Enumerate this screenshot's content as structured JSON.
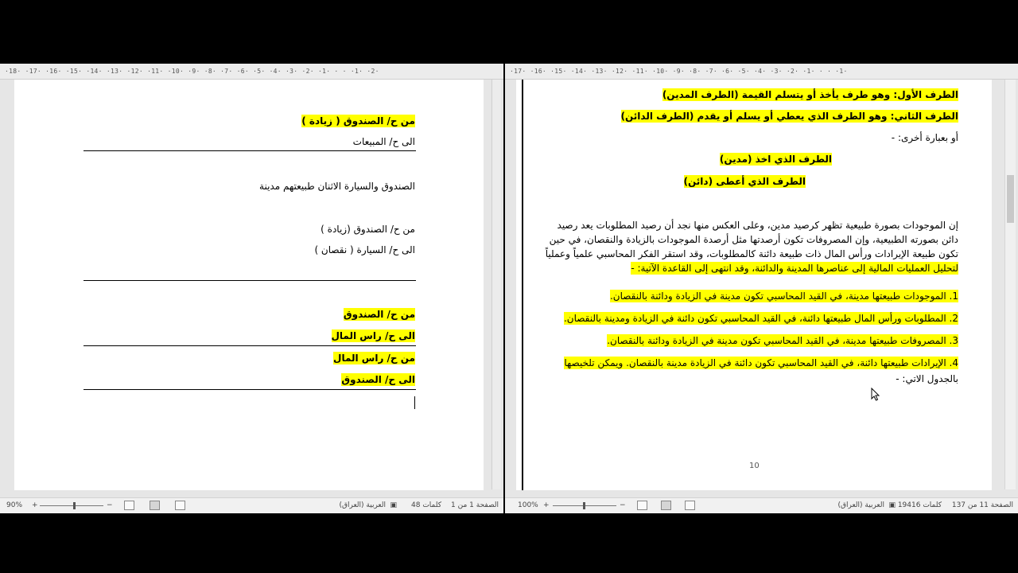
{
  "left_pane": {
    "ruler_text": "·18· ·17· ·16· ·15· ·14· ·13· ·12· ·11· ·10· ·9· ·8· ·7· ·6· ·5· ·4· ·3· ·2· ·1· · · ·1· ·2·",
    "lines": {
      "l1": "من ح/ الصندوق ( زيادة )",
      "l2": "الى ح/ المبيعات",
      "l3": "الصندوق     والسيارة الاثنان طبيعتهم مدينة",
      "l4": "من ح/ الصندوق (زيادة )",
      "l5": "الى ح/ السيارة ( نقصان )",
      "l6": "من ح/ الصندوق",
      "l7": "الى ح/ راس المال",
      "l8": "من ح/ راس المال",
      "l9": "الى ح/ الصندوق"
    },
    "status": {
      "page": "الصفحة 1 من 1",
      "words": "48 كلمات",
      "language": "العربية (العراق)",
      "zoom": "90%",
      "plus": "+",
      "minus": "−"
    }
  },
  "right_pane": {
    "ruler_text": "·17· ·16· ·15· ·14· ·13· ·12· ·11· ·10· ·9· ·8· ·7· ·6· ·5· ·4· ·3· ·2· ·1· · · ·1·",
    "lines": {
      "r1": "الطرف الأول: وهو طرف يأخذ أو يتسلم القيمة (الطرف المدين)",
      "r2": "الطرف الثاني: وهو الطرف الذي يعطي أو يسلم أو يقدم (الطرف الدائن)",
      "r3": "أو بعبارة أخرى: -",
      "r4": "الطرف الذي اخذ (مدين)",
      "r5": "الطرف الذي أعطى (دائن)",
      "p1": "إن الموجودات بصورة طبيعية تظهر كرصيد مدين، وعلى العكس منها نجد أن رصيد المطلوبات يعد رصيد",
      "p2": "دائن بصورته الطبيعية، وإن المصروفات تكون أرصدتها مثل أرصدة الموجودات بالزيادة والنقصان، في حين",
      "p3": "تكون طبيعة الإيرادات ورأس المال ذات طبيعة دائنة كالمطلوبات، وقد استقر الفكر المحاسبي علمياً وعملياً",
      "p4": "لتحليل العمليات المالية إلى عناصرها المدينة والدائنة، وقد انتهى إلى القاعدة الآتية: -",
      "n1": "1. الموجودات طبيعتها مدينة، في القيد المحاسبي تكون مدينة في الزيادة ودائنة بالنقصان.",
      "n2": "2. المطلوبات ورأس المال طبيعتها دائنة، في القيد المحاسبي تكون دائنة في الزيادة ومدينة بالنقصان.",
      "n3": "3. المصروفات طبيعتها مدينة، في القيد المحاسبي تكون مدينة في الزيادة ودائنة بالنقصان.",
      "n4": "4. الإيرادات طبيعتها دائنة، في القيد المحاسبي تكون دائنة في الزيادة مدينة بالنقصان. ويمكن تلخيصها",
      "n5": "بالجدول الاتي: -",
      "page_number": "10"
    },
    "status": {
      "page": "الصفحة 11 من 137",
      "words": "19416 كلمات",
      "language": "العربية (العراق)",
      "zoom": "100%",
      "plus": "+",
      "minus": "−"
    }
  },
  "colors": {
    "highlight": "#ffff00",
    "page": "#ffffff",
    "workspace": "#e6e6e6"
  }
}
